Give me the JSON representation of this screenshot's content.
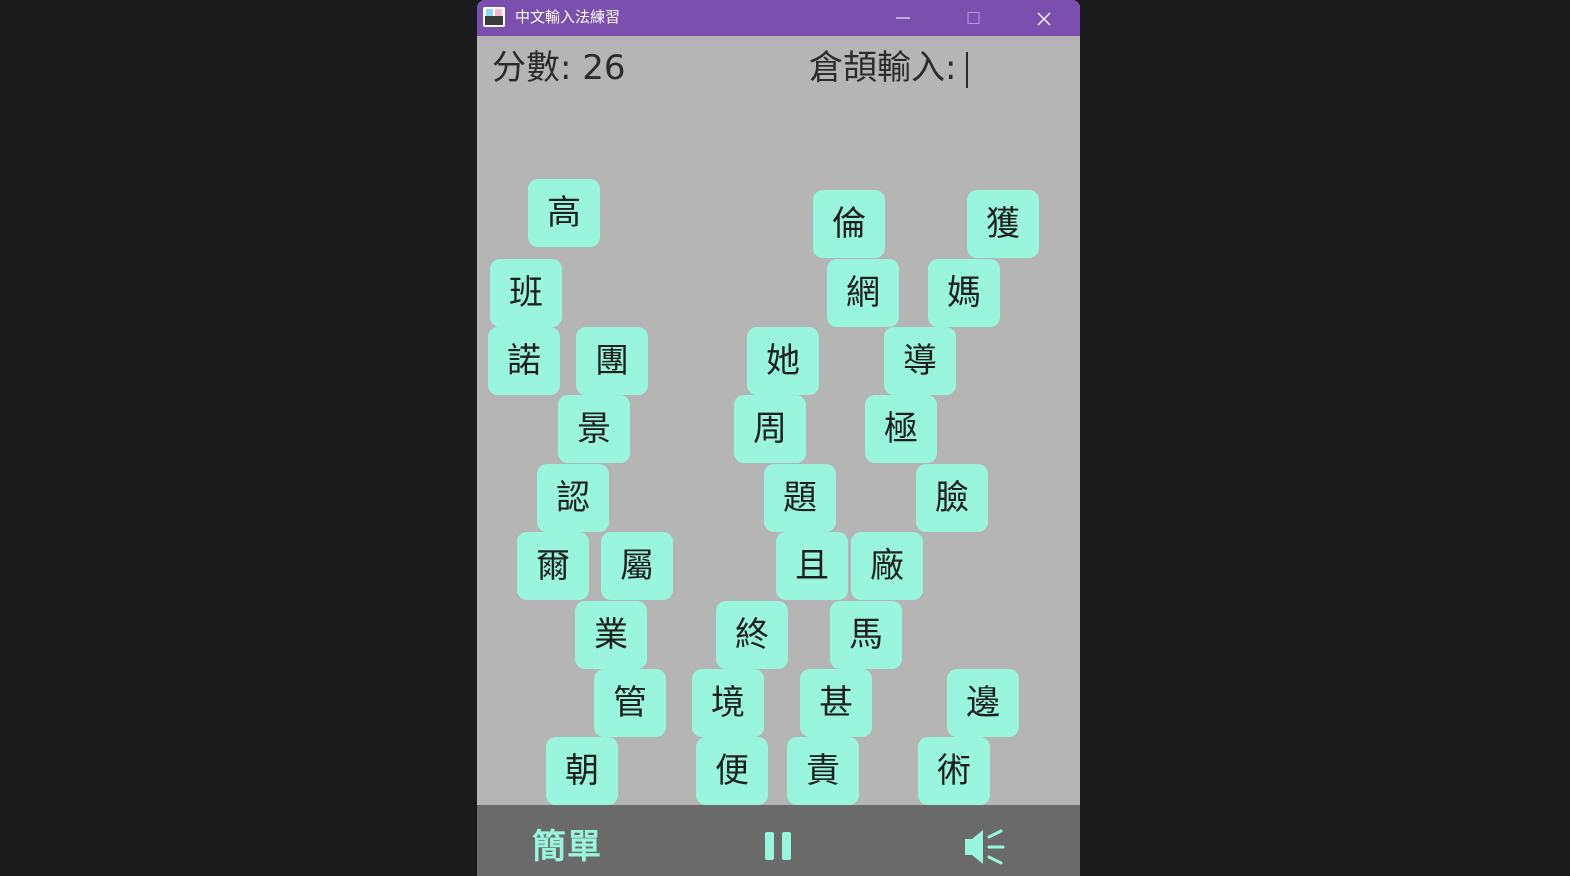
{
  "window": {
    "title": "中文輸入法練習",
    "accent": "#7b4fad",
    "tile_color": "#99f6dc"
  },
  "hud": {
    "score_label": "分數: 26",
    "input_label": "倉頡輸入:",
    "input_value": ""
  },
  "tiles": [
    "高",
    "倫",
    "獲",
    "班",
    "網",
    "媽",
    "諾",
    "團",
    "她",
    "導",
    "景",
    "周",
    "極",
    "認",
    "題",
    "臉",
    "爾",
    "屬",
    "且",
    "廠",
    "業",
    "終",
    "馬",
    "管",
    "境",
    "甚",
    "邊",
    "朝",
    "便",
    "責",
    "術"
  ],
  "bottom": {
    "level_label": "簡單",
    "pause_icon": "pause-icon",
    "sound_icon": "speaker-icon"
  }
}
